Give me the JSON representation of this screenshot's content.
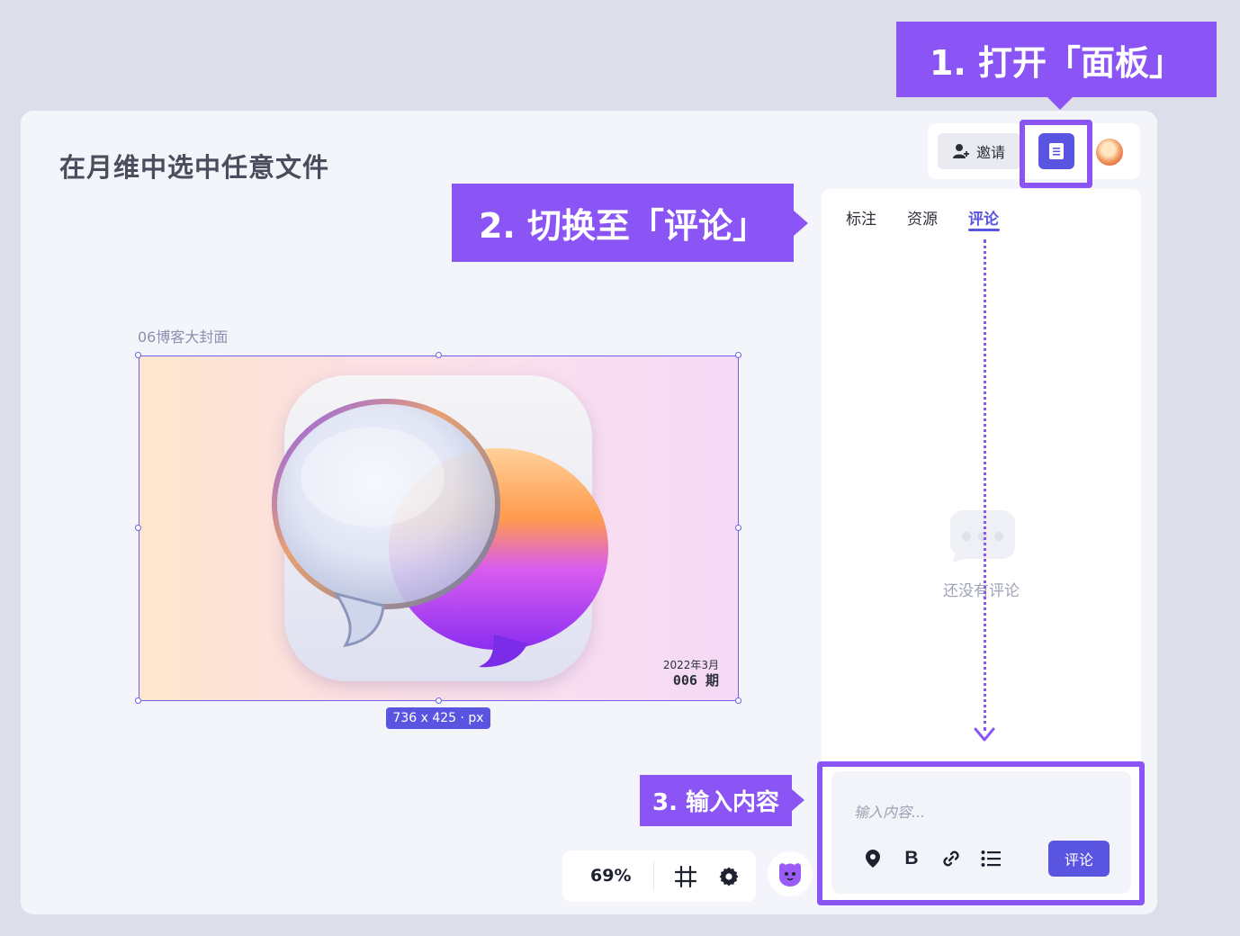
{
  "header": {
    "title": "在月维中选中任意文件",
    "invite_label": "邀请",
    "panel_button_icon": "document-panel-icon",
    "avatar_icon": "user-avatar"
  },
  "callouts": {
    "step1": "1. 打开「面板」",
    "step2": "2. 切换至「评论」",
    "step3": "3. 输入内容"
  },
  "panel": {
    "tabs": [
      {
        "label": "标注"
      },
      {
        "label": "资源"
      },
      {
        "label": "评论",
        "active": true
      }
    ],
    "empty_text": "还没有评论",
    "composer": {
      "placeholder": "输入内容...",
      "tools": [
        "pin-icon",
        "bold-icon",
        "link-icon",
        "list-icon"
      ],
      "bold_label": "B",
      "submit_label": "评论"
    }
  },
  "canvas": {
    "frame_label": "06博客大封面",
    "issue_date": "2022年3月",
    "issue_number": "006 期",
    "size_label": "736 x 425 · px"
  },
  "zoombar": {
    "zoom": "69%",
    "icons": [
      "frame-grid-icon",
      "gear-icon"
    ]
  },
  "colors": {
    "accent": "#5a55e0",
    "callout": "#8b55f5"
  }
}
